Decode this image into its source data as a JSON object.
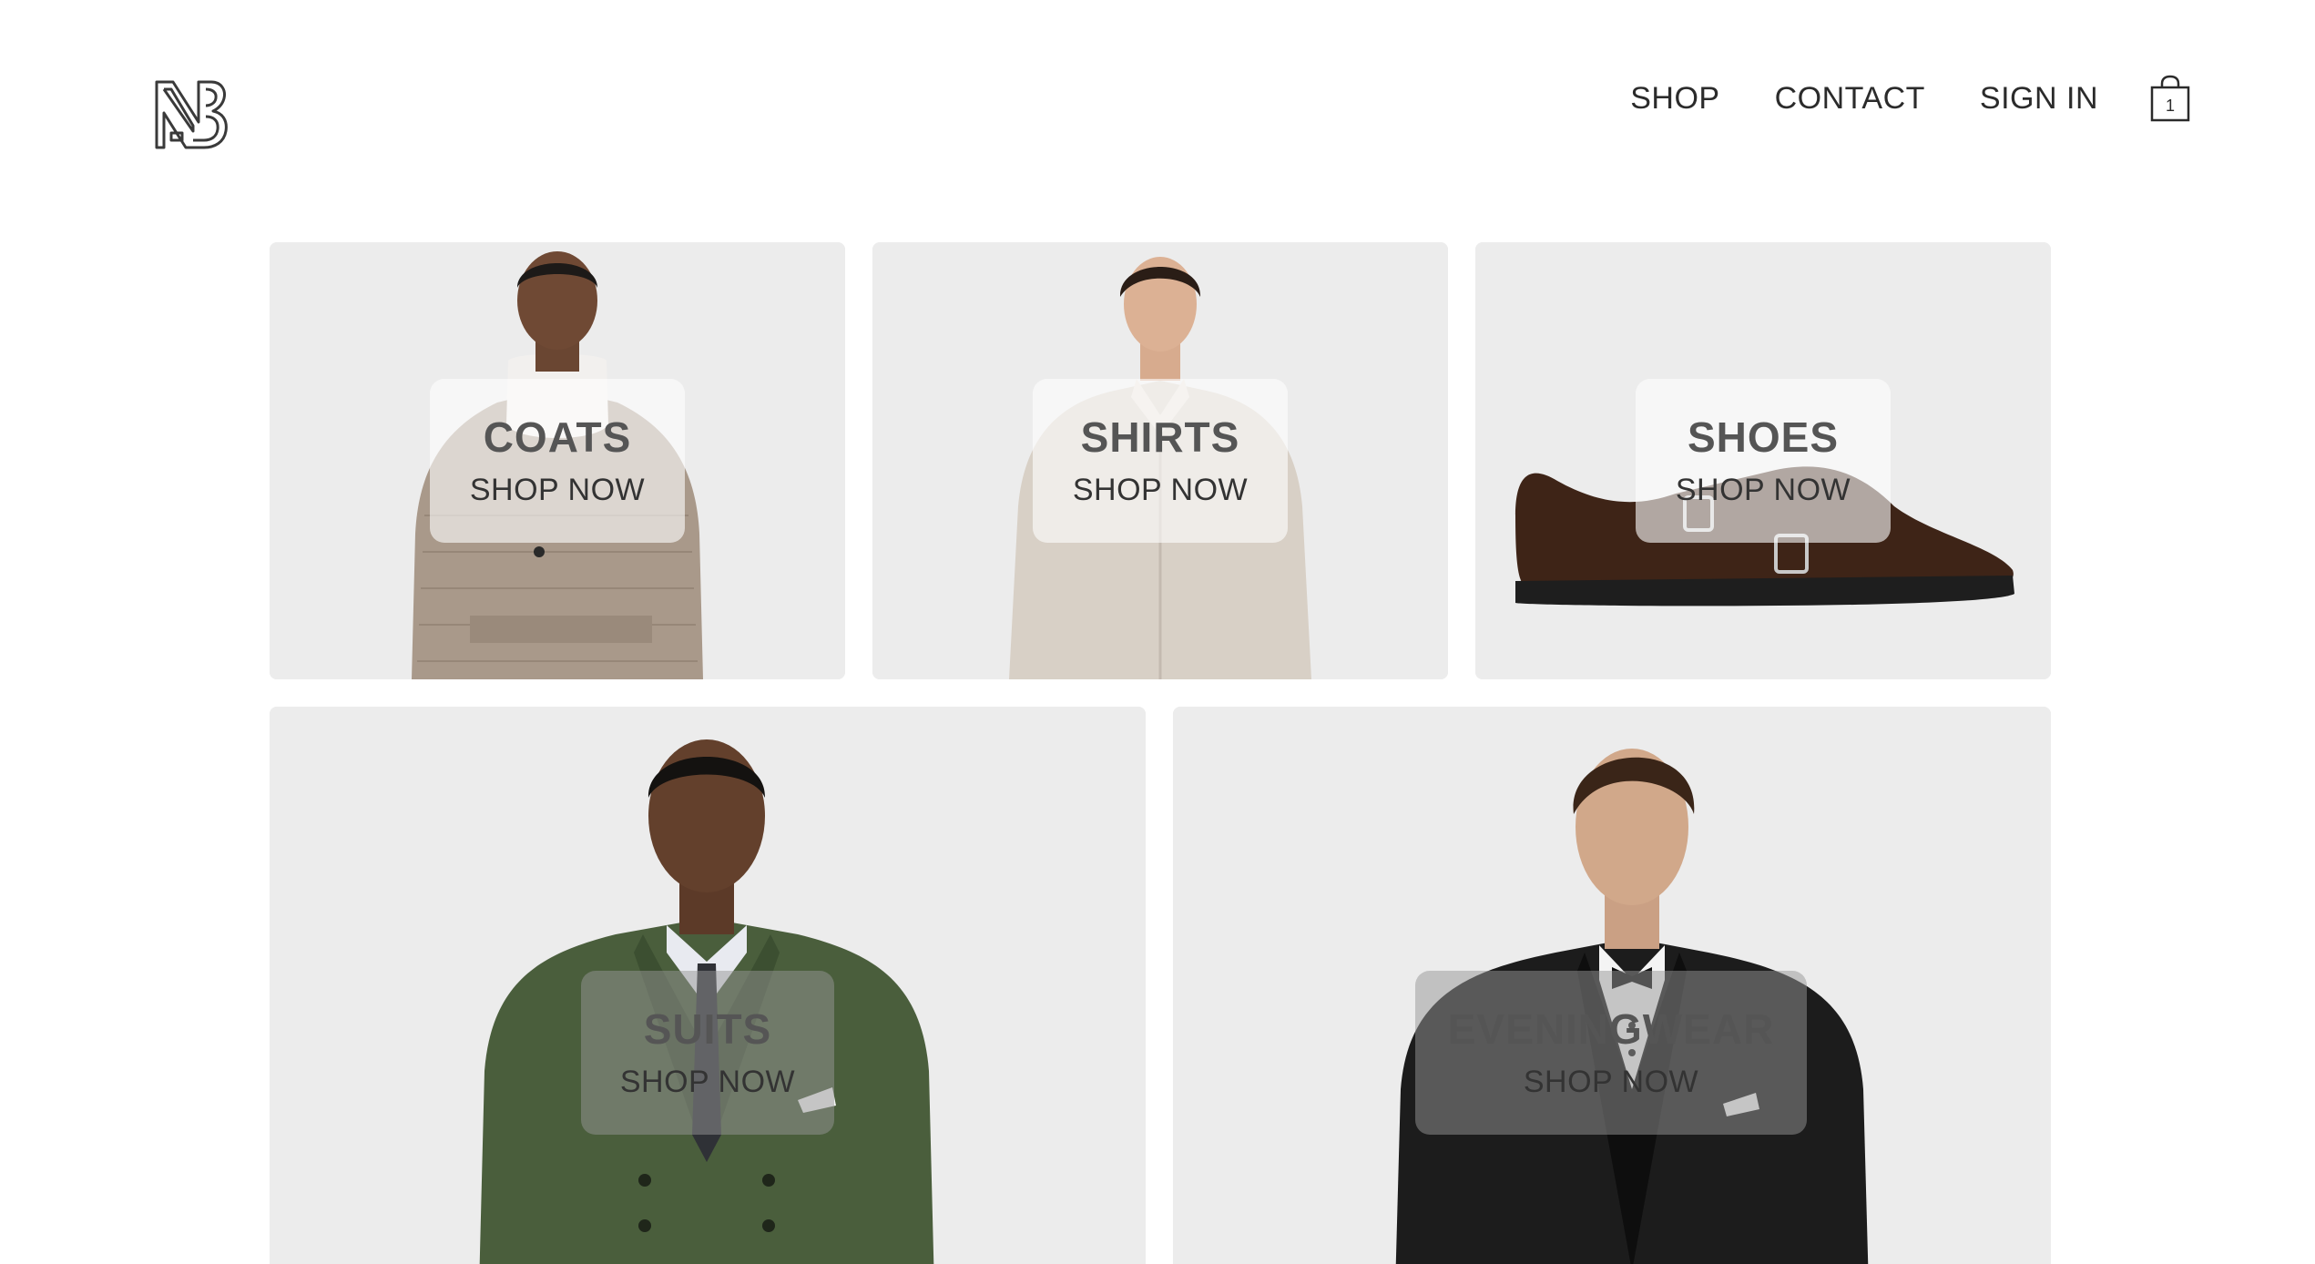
{
  "header": {
    "logo_icon": "nb-monogram-logo",
    "nav": [
      {
        "label": "SHOP"
      },
      {
        "label": "CONTACT"
      },
      {
        "label": "SIGN IN"
      }
    ],
    "cart": {
      "icon": "shopping-bag-icon",
      "count": "1"
    }
  },
  "categories": [
    {
      "name": "COATS",
      "cta": "SHOP NOW"
    },
    {
      "name": "SHIRTS",
      "cta": "SHOP NOW"
    },
    {
      "name": "SHOES",
      "cta": "SHOP NOW"
    },
    {
      "name": "SUITS",
      "cta": "SHOP NOW"
    },
    {
      "name": "EVENINGWEAR",
      "cta": "SHOP NOW"
    }
  ],
  "colors": {
    "background": "#ffffff",
    "tile_background": "#ececec",
    "text": "#2b2b2b",
    "category_text": "#555555"
  }
}
